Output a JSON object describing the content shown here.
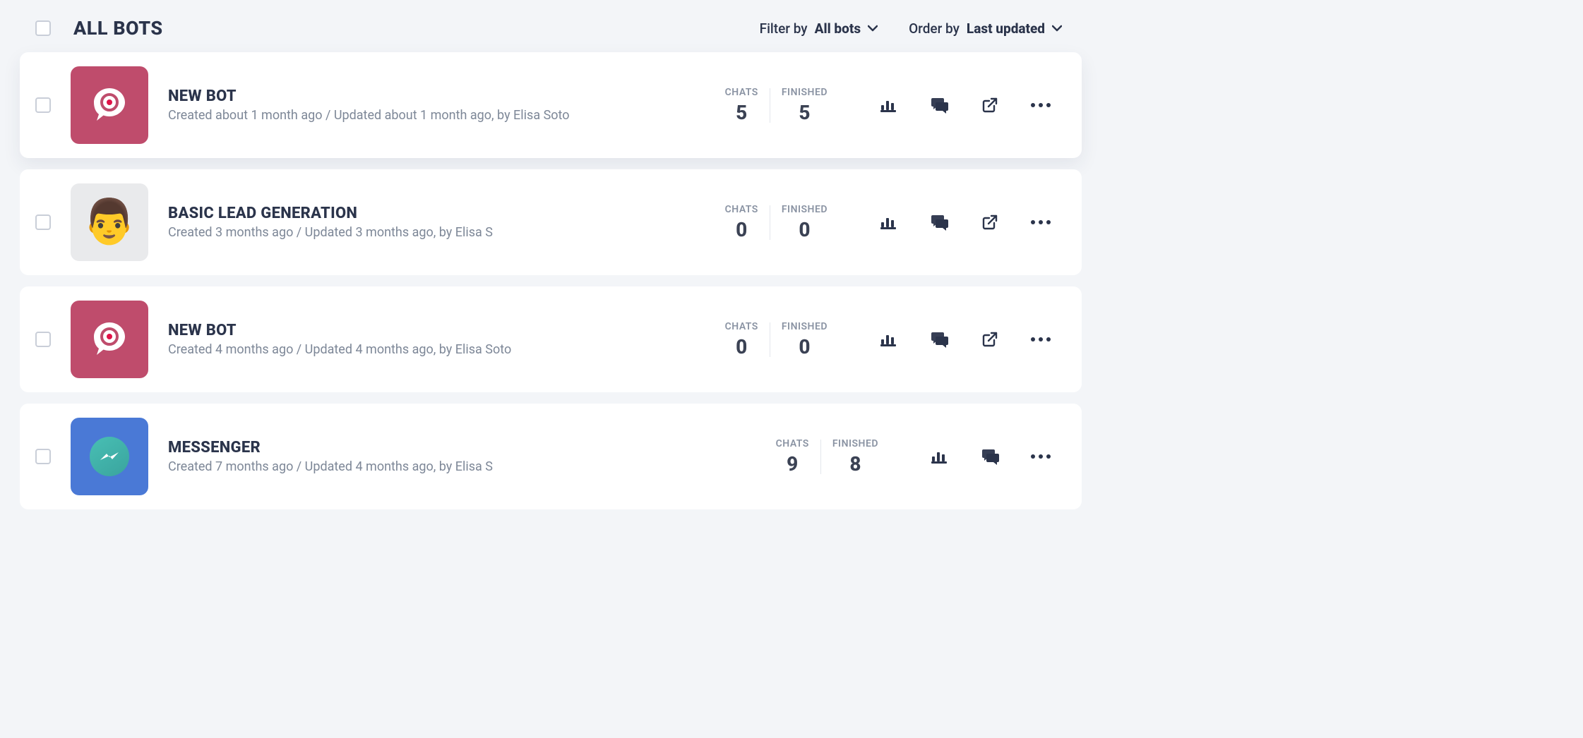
{
  "header": {
    "title": "ALL BOTS",
    "filter_label": "Filter by",
    "filter_value": "All bots",
    "order_label": "Order by",
    "order_value": "Last updated"
  },
  "stats_labels": {
    "chats": "CHATS",
    "finished": "FINISHED"
  },
  "bots": [
    {
      "name": "NEW BOT",
      "meta": "Created about 1 month ago / Updated about 1 month ago, by Elisa Soto",
      "chats": "5",
      "finished": "5",
      "avatar": "landbot",
      "hover": true,
      "show_share": true
    },
    {
      "name": "BASIC LEAD GENERATION",
      "meta": "Created 3 months ago / Updated 3 months ago, by Elisa S",
      "chats": "0",
      "finished": "0",
      "avatar": "person",
      "hover": false,
      "show_share": true
    },
    {
      "name": "NEW BOT",
      "meta": "Created 4 months ago / Updated 4 months ago, by Elisa Soto",
      "chats": "0",
      "finished": "0",
      "avatar": "landbot",
      "hover": false,
      "show_share": true
    },
    {
      "name": "MESSENGER",
      "meta": "Created 7 months ago / Updated 4 months ago, by Elisa S",
      "chats": "9",
      "finished": "8",
      "avatar": "messenger",
      "hover": false,
      "show_share": false
    }
  ]
}
